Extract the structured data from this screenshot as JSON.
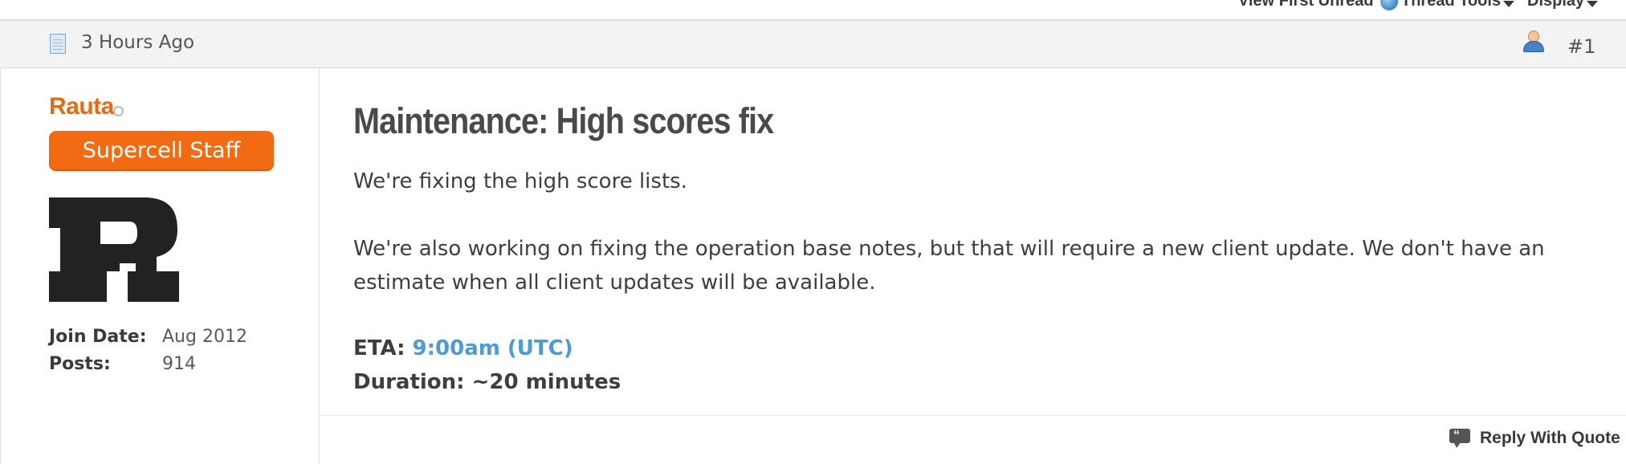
{
  "toolbar": {
    "view_first_unread": "View First Unread",
    "thread_tools": "Thread Tools",
    "display": "Display"
  },
  "post": {
    "date": "3 Hours Ago",
    "number": "#1",
    "title": "Maintenance: High scores fix",
    "paragraphs": [
      "We're fixing the high score lists.",
      "We're also working on fixing the operation base notes, but that will require a new client update. We don't have an estimate when all client updates will be available."
    ],
    "eta_label": "ETA:",
    "eta_value": "9:00am (UTC)",
    "duration": "Duration: ~20 minutes",
    "reply_with_quote": "Reply With Quote"
  },
  "user": {
    "name": "Rauta",
    "rank": "Supercell Staff",
    "avatar_letter": "R",
    "join_date_label": "Join Date:",
    "join_date": "Aug 2012",
    "posts_label": "Posts:",
    "posts": "914"
  },
  "icons": {
    "post_icon": "document-icon",
    "view_first_unread": "globe-icon",
    "user_profile": "user-icon",
    "reply_with_quote": "quote-bubble-icon"
  },
  "colors": {
    "username": "#e86a10",
    "rank_badge": "#f26a12",
    "link": "#4a9bd6"
  }
}
